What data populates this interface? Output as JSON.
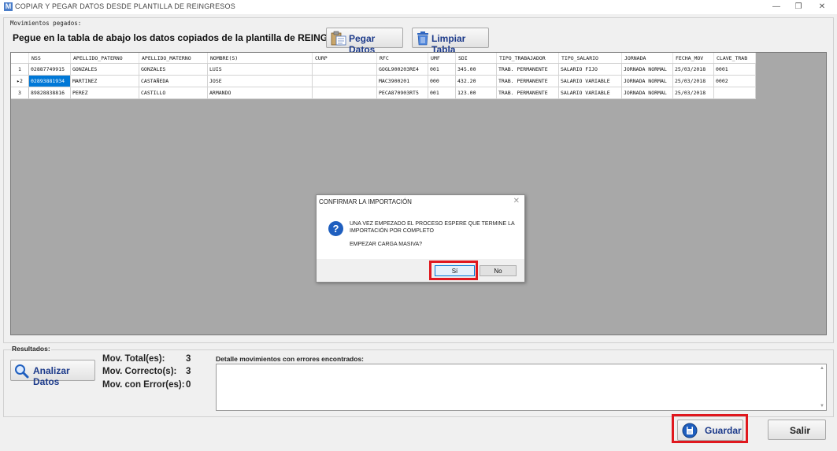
{
  "window": {
    "app_icon": "M",
    "title": "COPIAR Y PEGAR DATOS DESDE PLANTILLA DE REINGRESOS",
    "minimize": "—",
    "restore": "❐",
    "close": "✕"
  },
  "pasted_group": {
    "label": "Movimientos pegados:",
    "instruction": "Pegue en la tabla de abajo los datos copiados de la plantilla de REINGRESOS.",
    "paste_button": "Pegar Datos",
    "clear_button": "Limpiar Tabla"
  },
  "table": {
    "columns": [
      "NSS",
      "APELLIDO_PATERNO",
      "APELLIDO_MATERNO",
      "NOMBRE(S)",
      "CURP",
      "RFC",
      "UMF",
      "SDI",
      "TIPO_TRABAJADOR",
      "TIPO_SALARIO",
      "JORNADA",
      "FECHA_MOV",
      "CLAVE_TRAB"
    ],
    "rows": [
      {
        "num": "1",
        "marker": "",
        "cells": [
          "02887749915",
          "GONZALES",
          "GONZALES",
          "LUIS",
          "",
          "GOGL900203RE4",
          "001",
          "345.00",
          "TRAB. PERMANENTE",
          "SALARIO FIJO",
          "JORNADA NORMAL",
          "25/03/2018",
          "0001"
        ]
      },
      {
        "num": "2",
        "marker": "▸",
        "cells": [
          "02893881934",
          "MARTINEZ",
          "CASTAÑEDA",
          "JOSE",
          "",
          "MAC3900201",
          "000",
          "432.20",
          "TRAB. PERMANENTE",
          "SALARIO VARIABLE",
          "JORNADA NORMAL",
          "25/03/2018",
          "0002"
        ]
      },
      {
        "num": "3",
        "marker": "",
        "cells": [
          "89828838816",
          "PEREZ",
          "CASTILLO",
          "ARMANDO",
          "",
          "PECA870903RT5",
          "001",
          "123.00",
          "TRAB. PERMANENTE",
          "SALARIO VARIABLE",
          "JORNADA NORMAL",
          "25/03/2018",
          ""
        ]
      }
    ]
  },
  "dialog": {
    "title": "CONFIRMAR LA IMPORTACIÓN",
    "close": "✕",
    "icon": "?",
    "message": "UNA VEZ EMPEZADO EL PROCESO ESPERE QUE TERMINE LA IMPORTACIÓN POR COMPLETO",
    "question": "EMPEZAR CARGA MASIVA?",
    "yes_label": "Sí",
    "no_label": "No"
  },
  "results": {
    "label": "Resultados:",
    "analyze_button": "Analizar Datos",
    "total_label": "Mov. Total(es):",
    "total_value": "3",
    "correct_label": "Mov. Correcto(s):",
    "correct_value": "3",
    "error_label": "Mov. con Error(es):",
    "error_value": "0",
    "detail_label": "Detalle movimientos con errores encontrados:",
    "detail_text": ""
  },
  "actions": {
    "save_label": "Guardar",
    "exit_label": "Salir"
  },
  "icons": {
    "paste": "paste-icon",
    "clear": "trash-icon",
    "analyze": "magnifier-icon",
    "save": "save-disk-icon",
    "question": "question-icon"
  },
  "colors": {
    "highlight_box": "#e0181e",
    "selected_cell": "#0078d7",
    "button_text": "#1c3a8a",
    "question_icon": "#1f5fbf"
  }
}
